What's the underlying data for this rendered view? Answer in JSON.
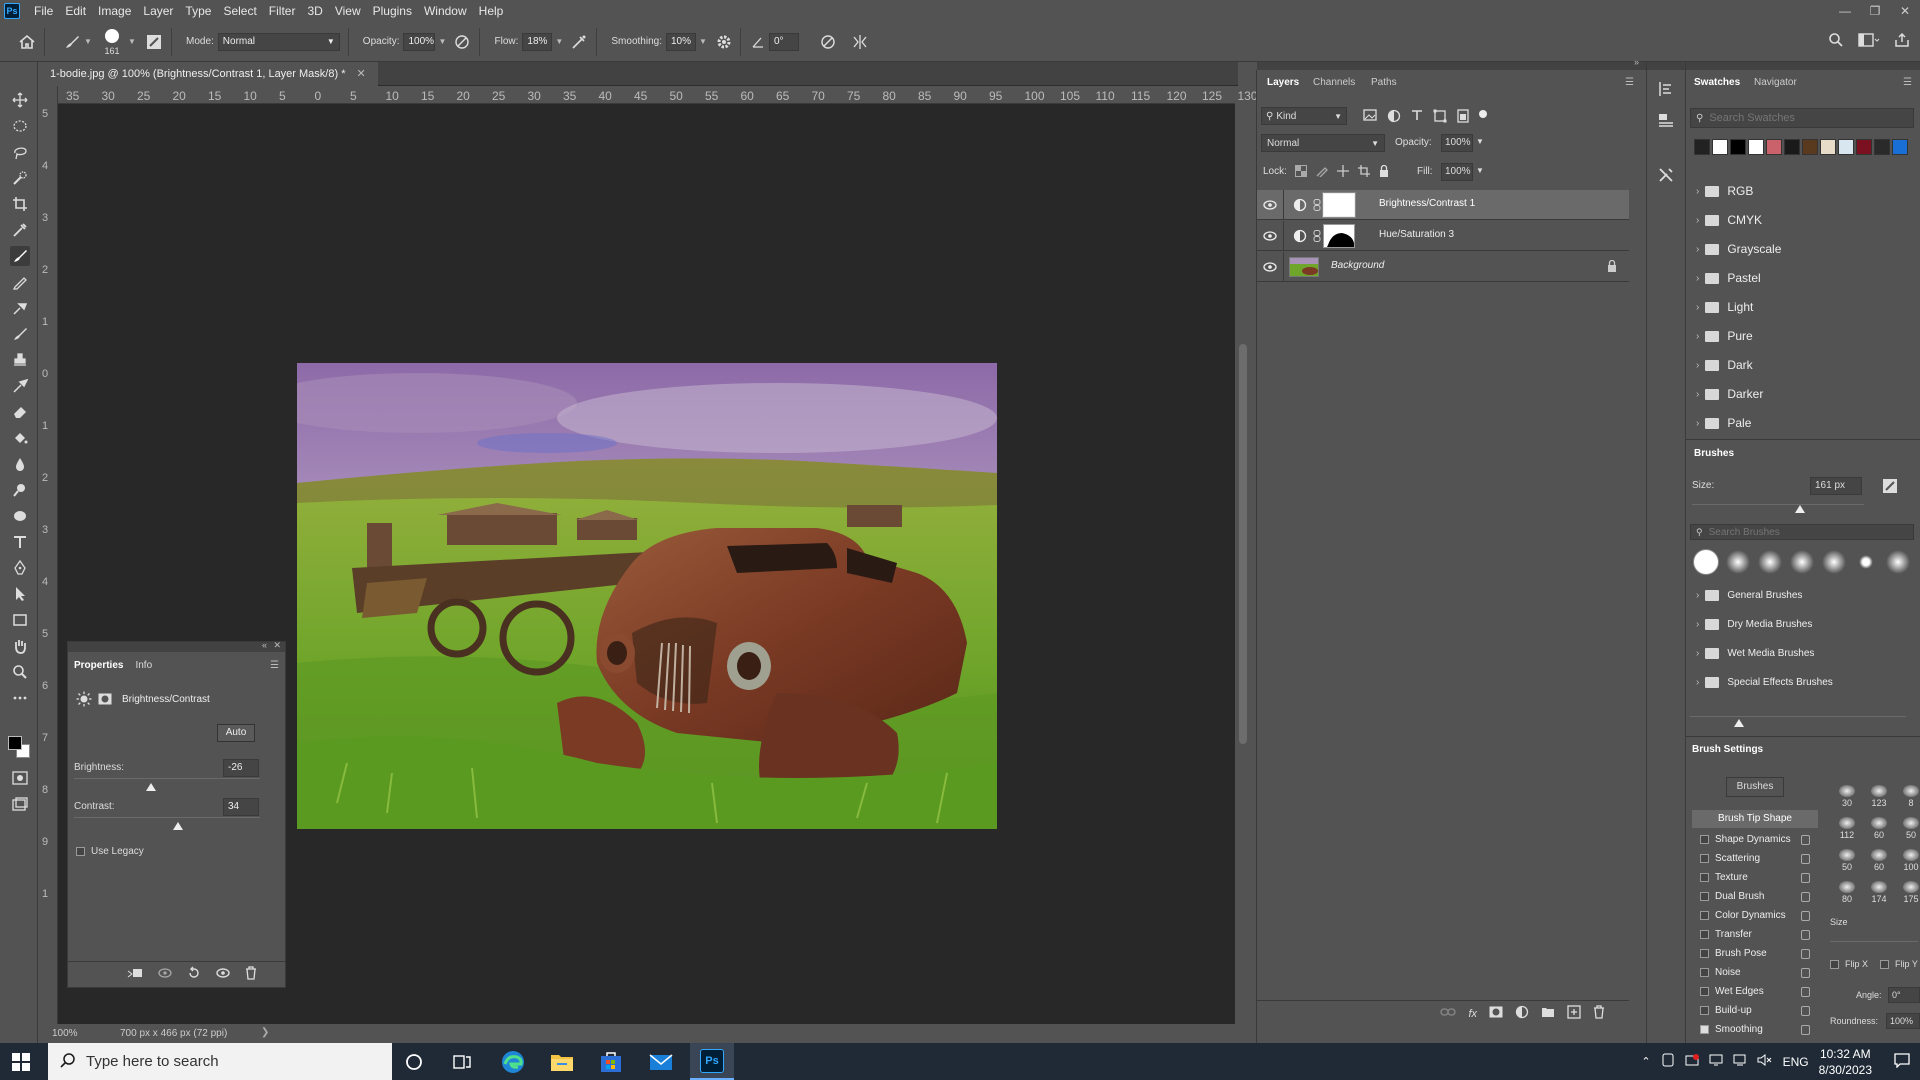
{
  "menubar": {
    "logo": "Ps",
    "items": [
      "File",
      "Edit",
      "Image",
      "Layer",
      "Type",
      "Select",
      "Filter",
      "3D",
      "View",
      "Plugins",
      "Window",
      "Help"
    ]
  },
  "options": {
    "brush_size": "161",
    "mode_label": "Mode:",
    "mode_value": "Normal",
    "opacity_label": "Opacity:",
    "opacity_value": "100%",
    "flow_label": "Flow:",
    "flow_value": "18%",
    "smoothing_label": "Smoothing:",
    "smoothing_value": "10%",
    "angle_value": "0°"
  },
  "document": {
    "tab_title": "1-bodie.jpg @ 100% (Brightness/Contrast 1, Layer Mask/8) *",
    "ruler_top": [
      "35",
      "30",
      "25",
      "20",
      "15",
      "10",
      "5",
      "0",
      "5",
      "10",
      "15",
      "20",
      "25",
      "30",
      "35",
      "40",
      "45",
      "50",
      "55",
      "60",
      "65",
      "70",
      "75",
      "80",
      "85",
      "90",
      "95",
      "100",
      "105",
      "110",
      "115",
      "120",
      "125",
      "130"
    ],
    "ruler_left": [
      "5",
      "4",
      "3",
      "2",
      "1",
      "0",
      "1",
      "2",
      "3",
      "4",
      "5",
      "6",
      "7",
      "8",
      "9",
      "1"
    ],
    "zoom": "100%",
    "doc_info": "700 px x 466 px (72 ppi)"
  },
  "properties": {
    "tabs": [
      "Properties",
      "Info"
    ],
    "adjustment_name": "Brightness/Contrast",
    "auto_label": "Auto",
    "brightness_label": "Brightness:",
    "brightness_value": "-26",
    "brightness_level": -26,
    "contrast_label": "Contrast:",
    "contrast_value": "34",
    "contrast_level": 34,
    "use_legacy_label": "Use Legacy"
  },
  "layers": {
    "tabs": [
      "Layers",
      "Channels",
      "Paths"
    ],
    "filter_kind": "Kind",
    "blend_mode": "Normal",
    "opacity_label": "Opacity:",
    "opacity_value": "100%",
    "lock_label": "Lock:",
    "fill_label": "Fill:",
    "fill_value": "100%",
    "rows": [
      {
        "name": "Brightness/Contrast 1"
      },
      {
        "name": "Hue/Saturation 3"
      },
      {
        "name": "Background"
      }
    ]
  },
  "swatches": {
    "tabs": [
      "Swatches",
      "Navigator"
    ],
    "search_placeholder": "Search Swatches",
    "colors": [
      "#222222",
      "#ffffff",
      "#000000",
      "#ffffff",
      "#c9626b",
      "#1a1a1a",
      "#5a3a1e",
      "#e8dcc8",
      "#d8e6ef",
      "#7a1020",
      "#2a2a2a",
      "#1a6fd6"
    ],
    "groups": [
      "RGB",
      "CMYK",
      "Grayscale",
      "Pastel",
      "Light",
      "Pure",
      "Dark",
      "Darker",
      "Pale"
    ]
  },
  "brushes": {
    "tab": "Brushes",
    "size_label": "Size:",
    "size_value": "161 px",
    "search_placeholder": "Search Brushes",
    "groups": [
      "General Brushes",
      "Dry Media Brushes",
      "Wet Media Brushes",
      "Special Effects Brushes"
    ]
  },
  "brush_settings": {
    "tab": "Brush Settings",
    "brushes_button": "Brushes",
    "tip_shape": "Brush Tip Shape",
    "options": [
      {
        "label": "Shape Dynamics",
        "checked": false
      },
      {
        "label": "Scattering",
        "checked": false
      },
      {
        "label": "Texture",
        "checked": false
      },
      {
        "label": "Dual Brush",
        "checked": false
      },
      {
        "label": "Color Dynamics",
        "checked": false
      },
      {
        "label": "Transfer",
        "checked": false
      },
      {
        "label": "Brush Pose",
        "checked": false
      },
      {
        "label": "Noise",
        "checked": false
      },
      {
        "label": "Wet Edges",
        "checked": false
      },
      {
        "label": "Build-up",
        "checked": false
      },
      {
        "label": "Smoothing",
        "checked": true
      }
    ],
    "tip_sizes": [
      "30",
      "123",
      "8",
      "112",
      "60",
      "50",
      "50",
      "60",
      "100",
      "80",
      "174",
      "175"
    ],
    "size_label": "Size",
    "flip_x": "Flip X",
    "flip_y": "Flip Y",
    "angle_label": "Angle:",
    "angle_value": "0°",
    "roundness_label": "Roundness:",
    "roundness_value": "100%"
  },
  "taskbar": {
    "search_placeholder": "Type here to search",
    "language": "ENG",
    "time": "10:32 AM",
    "date": "8/30/2023"
  }
}
